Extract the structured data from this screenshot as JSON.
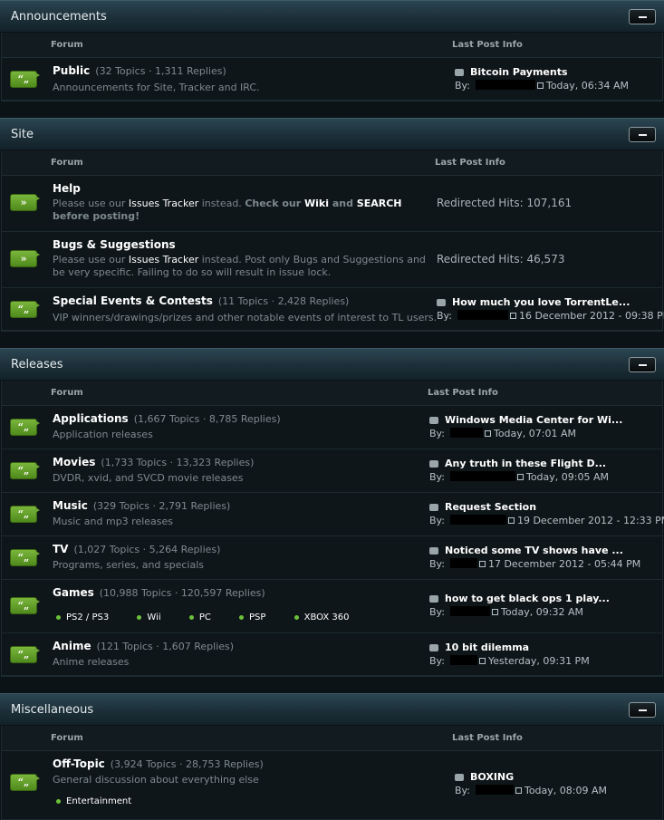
{
  "categories": [
    {
      "title": "Announcements",
      "col_forum": "Forum",
      "col_last": "Last Post Info",
      "forums": [
        {
          "name": "Public",
          "stats": "(32 Topics · 1,311 Replies)",
          "desc": "Announcements for Site, Tracker and IRC.",
          "last_title": "Bitcoin Payments",
          "by": "By:",
          "time": "Today, 06:34 AM",
          "icon": "“„"
        }
      ]
    },
    {
      "title": "Site",
      "col_forum": "Forum",
      "col_last": "Last Post Info",
      "forums": [
        {
          "name": "Help",
          "desc_parts": [
            "Please use our ",
            "Issues Tracker",
            " instead. ",
            "Check our ",
            "Wiki",
            " and ",
            "SEARCH",
            " before posting!"
          ],
          "redirect": "Redirected Hits: 107,161",
          "icon": "»"
        },
        {
          "name": "Bugs & Suggestions",
          "desc_parts": [
            "Please use our ",
            "Issues Tracker",
            " instead. Post only Bugs and Suggestions and be very specific. Failing to do so will result in issue lock."
          ],
          "redirect": "Redirected Hits: 46,573",
          "icon": "»"
        },
        {
          "name": "Special Events & Contests",
          "stats": "(11 Topics · 2,428 Replies)",
          "desc": "VIP winners/drawings/prizes and other notable events of interest to TL users.",
          "last_title": "How much you love TorrentLe...",
          "by": "By:",
          "time": "16 December 2012 - 09:38 PM",
          "icon": "“„"
        }
      ]
    },
    {
      "title": "Releases",
      "col_forum": "Forum",
      "col_last": "Last Post Info",
      "forums": [
        {
          "name": "Applications",
          "stats": "(1,667 Topics · 8,785 Replies)",
          "desc": "Application releases",
          "last_title": "Windows Media Center for Wi...",
          "by": "By:",
          "time": "Today, 07:01 AM",
          "icon": "“„"
        },
        {
          "name": "Movies",
          "stats": "(1,733 Topics · 13,323 Replies)",
          "desc": "DVDR, xvid, and SVCD movie releases",
          "last_title": "Any truth in these Flight D...",
          "by": "By:",
          "time": "Today, 09:05 AM",
          "icon": "“„"
        },
        {
          "name": "Music",
          "stats": "(329 Topics · 2,791 Replies)",
          "desc": "Music and mp3 releases",
          "last_title": "Request Section",
          "by": "By:",
          "time": "19 December 2012 - 12:33 PM",
          "icon": "“„"
        },
        {
          "name": "TV",
          "stats": "(1,027 Topics · 5,264 Replies)",
          "desc": "Programs, series, and specials",
          "last_title": "Noticed some TV shows have ...",
          "by": "By:",
          "time": "17 December 2012 - 05:44 PM",
          "icon": "“„"
        },
        {
          "name": "Games",
          "stats": "(10,988 Topics · 120,597 Replies)",
          "subforums": [
            "PS2 / PS3",
            "Wii",
            "PC",
            "PSP",
            "XBOX 360"
          ],
          "last_title": "how to get black ops 1 play...",
          "by": "By:",
          "time": "Today, 09:32 AM",
          "icon": "“„"
        },
        {
          "name": "Anime",
          "stats": "(121 Topics · 1,607 Replies)",
          "desc": "Anime releases",
          "last_title": "10 bit dilemma",
          "by": "By:",
          "time": "Yesterday, 09:31 PM",
          "icon": "“„"
        }
      ]
    },
    {
      "title": "Miscellaneous",
      "col_forum": "Forum",
      "col_last": "Last Post Info",
      "forums": [
        {
          "name": "Off-Topic",
          "stats": "(3,924 Topics · 28,753 Replies)",
          "desc": "General discussion about everything else",
          "subforums": [
            "Entertainment"
          ],
          "last_title": "BOXING",
          "by": "By:",
          "time": "Today, 08:09 AM",
          "icon": "“„"
        }
      ]
    }
  ]
}
